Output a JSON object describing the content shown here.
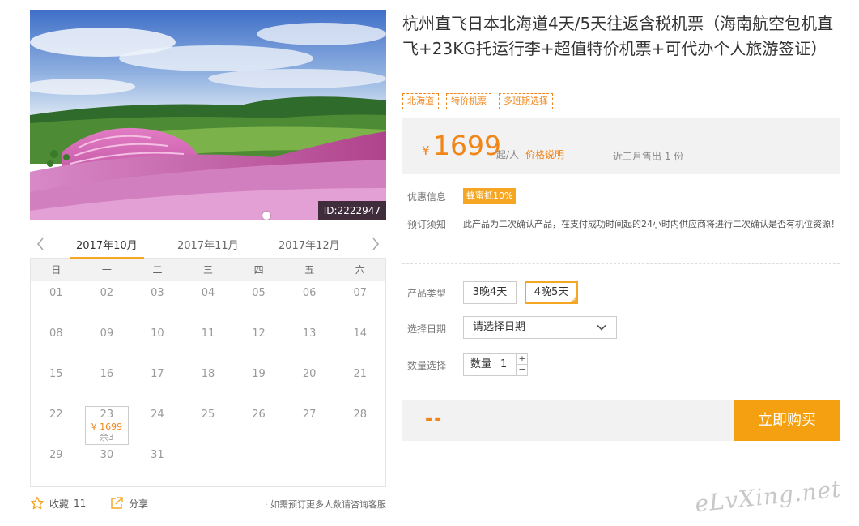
{
  "hero": {
    "image_alt": "Pink flower fields on hills in Hokkaido",
    "id_label": "ID:2222947"
  },
  "calendar": {
    "months": [
      "2017年10月",
      "2017年11月",
      "2017年12月"
    ],
    "active_month": "2017年10月",
    "weekdays": [
      "日",
      "一",
      "二",
      "三",
      "四",
      "五",
      "六"
    ],
    "leading_blanks": 0,
    "days": [
      {
        "d": "01"
      },
      {
        "d": "02"
      },
      {
        "d": "03"
      },
      {
        "d": "04"
      },
      {
        "d": "05"
      },
      {
        "d": "06"
      },
      {
        "d": "07"
      },
      {
        "d": "08"
      },
      {
        "d": "09"
      },
      {
        "d": "10"
      },
      {
        "d": "11"
      },
      {
        "d": "12"
      },
      {
        "d": "13"
      },
      {
        "d": "14"
      },
      {
        "d": "15"
      },
      {
        "d": "16"
      },
      {
        "d": "17"
      },
      {
        "d": "18"
      },
      {
        "d": "19"
      },
      {
        "d": "20"
      },
      {
        "d": "21"
      },
      {
        "d": "22"
      },
      {
        "d": "23",
        "price": "¥ 1699",
        "remain": "余3",
        "selected": true
      },
      {
        "d": "24"
      },
      {
        "d": "25"
      },
      {
        "d": "26"
      },
      {
        "d": "27"
      },
      {
        "d": "28"
      },
      {
        "d": "29"
      },
      {
        "d": "30"
      },
      {
        "d": "31"
      }
    ]
  },
  "actions": {
    "favorite_label": "收藏",
    "favorite_count": "11",
    "share_label": "分享",
    "note": "· 如需预订更多人数请咨询客服"
  },
  "product": {
    "title": "杭州直飞日本北海道4天/5天往返含税机票（海南航空包机直飞+23KG托运行李+超值特价机票+可代办个人旅游签证）",
    "tags": [
      "北海道",
      "特价机票",
      "多班期选择"
    ],
    "price": {
      "currency": "¥",
      "value": "1699",
      "unit": "起/人",
      "explain": "价格说明",
      "sold": "近三月售出 1 份"
    },
    "promo_label": "优惠信息",
    "promo_badge": "蜂蜜抵10%",
    "notice_label": "预订须知",
    "notice_text": "此产品为二次确认产品，在支付成功时间起的24小时内供应商将进行二次确认是否有机位资源！",
    "type_label": "产品类型",
    "types": [
      "3晚4天",
      "4晚5天"
    ],
    "selected_type": "4晚5天",
    "date_label": "选择日期",
    "date_placeholder": "请选择日期",
    "qty_label": "数量选择",
    "qty_field_label": "数量",
    "qty_value": "1",
    "qty_plus": "+",
    "qty_minus": "−",
    "total": "--",
    "buy_label": "立即购买"
  },
  "watermark": "eLvXing.net",
  "colors": {
    "accent": "#f5a623",
    "price": "#f08519",
    "buy_button": "#f5a010",
    "panel_bg": "#f2f2f2"
  }
}
